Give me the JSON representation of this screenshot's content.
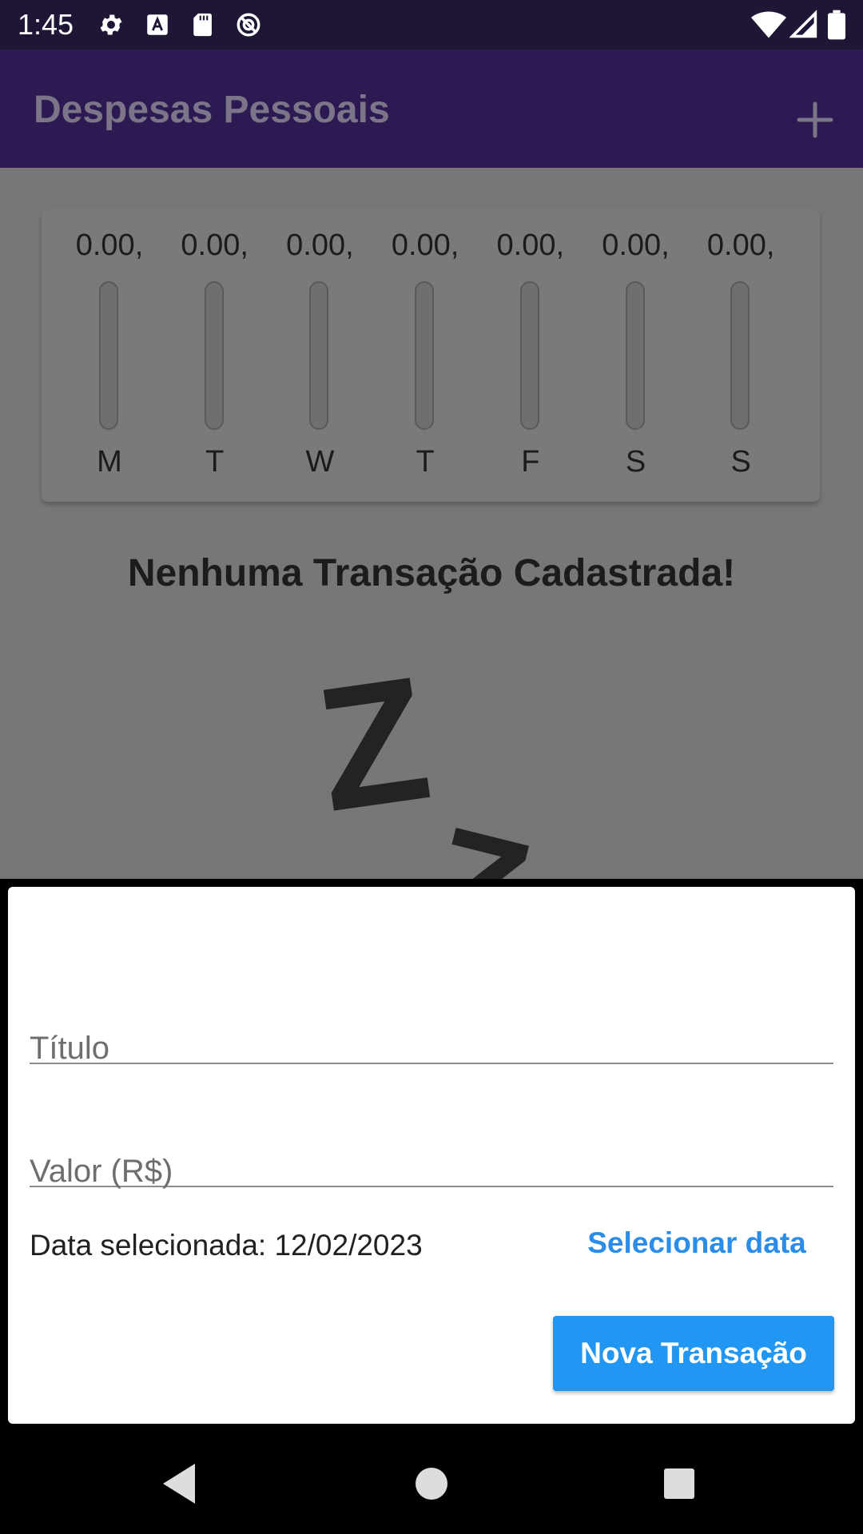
{
  "status_bar": {
    "time": "1:45",
    "icons": [
      "gear-icon",
      "text-a-icon",
      "sd-card-icon",
      "do-not-disturb-icon",
      "wifi-icon",
      "signal-icon",
      "battery-icon"
    ]
  },
  "app_bar": {
    "title": "Despesas Pessoais",
    "action_icon": "plus-icon"
  },
  "chart_data": {
    "type": "bar",
    "categories": [
      "M",
      "T",
      "W",
      "T",
      "F",
      "S",
      "S"
    ],
    "values": [
      0,
      0,
      0,
      0,
      0,
      0,
      0
    ],
    "value_labels": [
      "0.00,",
      "0.00,",
      "0.00,",
      "0.00,",
      "0.00,",
      "0.00,",
      "0.00,"
    ]
  },
  "empty_state": {
    "title": "Nenhuma Transação Cadastrada!",
    "icon": "zzz-icon"
  },
  "form": {
    "title_label": "Título",
    "value_label": "Valor (R$)",
    "date_text": "Data selecionada: 12/02/2023",
    "select_date_label": "Selecionar data",
    "submit_label": "Nova Transação"
  },
  "nav_bar": {
    "icons": [
      "back-icon",
      "home-icon",
      "recents-icon"
    ]
  },
  "colors": {
    "app_bar": "#2e1a52",
    "accent": "#2196f3",
    "scrim": "#777777"
  }
}
